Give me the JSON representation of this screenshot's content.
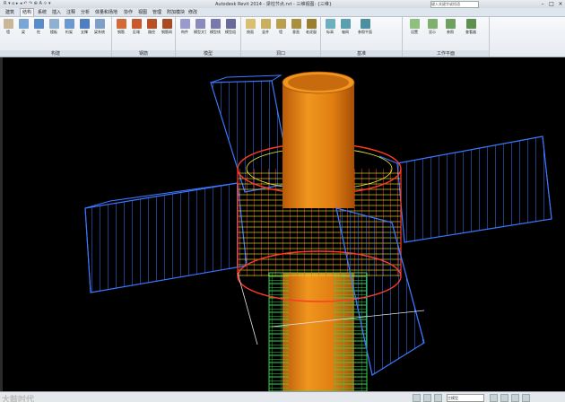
{
  "window": {
    "title": "Autodesk Revit 2014 - 梁柱节点.rvt - 三维视图: {三维}",
    "search_placeholder": "键入关键字或短语",
    "quick_access": "R ▾ ⌂ ▸ ◂ ↶ ↷ ⊕ A ⟐ ▾"
  },
  "tabs": [
    "建筑",
    "结构",
    "系统",
    "插入",
    "注释",
    "分析",
    "体量和场地",
    "协作",
    "视图",
    "管理",
    "附加模块",
    "修改"
  ],
  "ribbon_groups": [
    {
      "label": "构建",
      "tools": [
        "墙",
        "梁",
        "柱",
        "楼板",
        "桁架",
        "支撑",
        "梁系统"
      ]
    },
    {
      "label": "钢筋",
      "tools": [
        "钢筋",
        "区域",
        "路径",
        "钢筋网"
      ]
    },
    {
      "label": "模型",
      "tools": [
        "构件",
        "模型文字",
        "模型线",
        "模型组"
      ]
    },
    {
      "label": "洞口",
      "tools": [
        "按面",
        "竖井",
        "墙",
        "垂直",
        "老虎窗"
      ]
    },
    {
      "label": "基准",
      "tools": [
        "标高",
        "轴网",
        "参照平面"
      ]
    },
    {
      "label": "工作平面",
      "tools": [
        "设置",
        "显示",
        "参照",
        "查看器"
      ]
    }
  ],
  "status": {
    "watermark": "大鼓时代",
    "model_selector": "主模型"
  },
  "colors": {
    "background": "#000000",
    "concrete": "#e9851a",
    "rebar_red": "#ff3a24",
    "rebar_yellow": "#f3f03a",
    "rebar_green": "#2fd84a",
    "rebar_blue": "#3b78ff"
  }
}
